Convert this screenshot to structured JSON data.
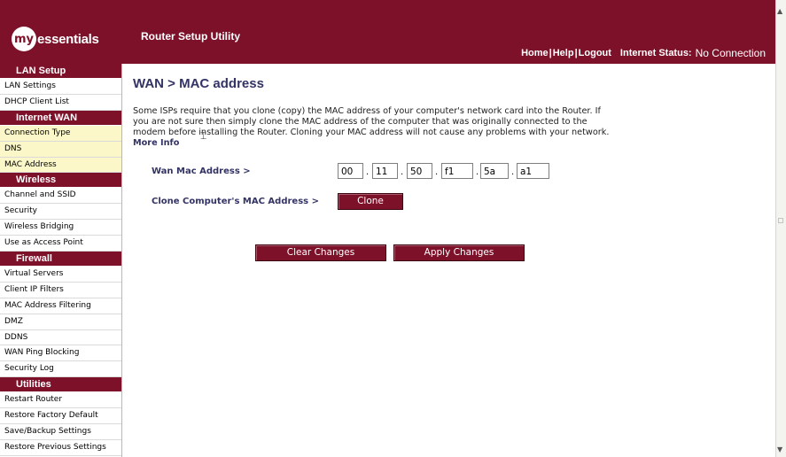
{
  "header": {
    "logo_prefix": "my",
    "logo_text": "essentials",
    "app_title": "Router Setup Utility",
    "nav": {
      "home": "Home",
      "help": "Help",
      "logout": "Logout",
      "separator": "|",
      "status_label": "Internet Status:",
      "status_value": "No Connection"
    }
  },
  "sidebar": {
    "sections": [
      {
        "title": "LAN Setup",
        "items": [
          "LAN Settings",
          "DHCP Client List"
        ]
      },
      {
        "title": "Internet WAN",
        "items": [
          "Connection Type",
          "DNS",
          "MAC Address"
        ]
      },
      {
        "title": "Wireless",
        "items": [
          "Channel and SSID",
          "Security",
          "Wireless Bridging",
          "Use as Access Point"
        ]
      },
      {
        "title": "Firewall",
        "items": [
          "Virtual Servers",
          "Client IP Filters",
          "MAC Address Filtering",
          "DMZ",
          "DDNS",
          "WAN Ping Blocking",
          "Security Log"
        ]
      },
      {
        "title": "Utilities",
        "items": [
          "Restart Router",
          "Restore Factory Default",
          "Save/Backup Settings",
          "Restore Previous Settings"
        ]
      }
    ],
    "highlight_color": "#fbf7c8"
  },
  "main": {
    "title": "WAN > MAC address",
    "description": "Some ISPs require that you clone (copy) the MAC address of your computer's network card into the Router. If you are not sure then simply clone the MAC address of the computer that was originally connected to the modem before installing the Router. Cloning your MAC address will not cause any problems with your network.",
    "more_info": "More Info",
    "wan_mac_label": "Wan Mac Address >",
    "mac_octets": [
      "00",
      "11",
      "50",
      "f1",
      "5a",
      "a1"
    ],
    "mac_separator": ".",
    "clone_label": "Clone Computer's MAC Address >",
    "clone_button": "Clone",
    "clear_button": "Clear Changes",
    "apply_button": "Apply Changes"
  },
  "colors": {
    "brand": "#7d1129",
    "heading_text": "#333366"
  }
}
